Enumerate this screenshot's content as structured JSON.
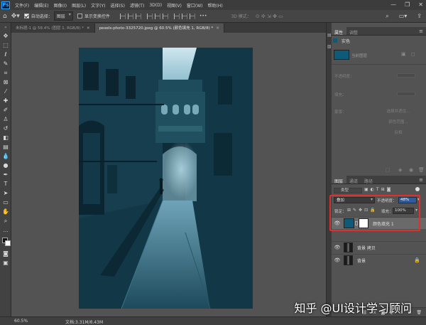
{
  "menu": {
    "logo": "Ps",
    "items": [
      "文件(F)",
      "编辑(E)",
      "图像(I)",
      "图层(L)",
      "文字(Y)",
      "选择(S)",
      "滤镜(T)",
      "3D(D)",
      "视图(V)",
      "窗口(W)",
      "帮助(H)"
    ],
    "window_controls": {
      "minimize": "—",
      "restore": "❐",
      "close": "✕"
    }
  },
  "options": {
    "auto_select_label": "自动选择：",
    "auto_select_value": "图层",
    "transform_label": "显示变换控件",
    "mode_3d_label": "3D 模式："
  },
  "tabs": [
    {
      "label": "未标题-1 @ 58.4% (图层 1, RGB/8) *",
      "active": false
    },
    {
      "label": "pexels-photo-3325720.jpeg @ 60.5% (颜色填充 1, RGB/8) *",
      "active": true
    }
  ],
  "properties_panel": {
    "tabs": [
      "属性",
      "调整"
    ],
    "title": "实色",
    "layer_comp": "当前图层",
    "labels": {
      "opacity": "不透明度：",
      "fill": "填充：",
      "mask": "蒙版："
    },
    "buttons": [
      "选择并遮住...",
      "颜色范围...",
      "反相"
    ]
  },
  "layers_panel": {
    "tabs": [
      "图层",
      "通道",
      "路径"
    ],
    "filter_kind": "类型",
    "blend_mode": "叠加",
    "opacity_label": "不透明度：",
    "opacity_value": "48%",
    "lock_label": "锁定：",
    "fill_label": "填充：",
    "fill_value": "100%",
    "layers": [
      {
        "name": "颜色填充 1",
        "selected": true,
        "locked": false
      },
      {
        "name": "背景 拷贝",
        "selected": false,
        "locked": false
      },
      {
        "name": "背景",
        "selected": false,
        "locked": true
      }
    ],
    "bottom_icons": [
      "link-icon",
      "fx-icon",
      "mask-icon",
      "adjustment-icon",
      "group-icon",
      "new-layer-icon",
      "delete-icon"
    ],
    "fx_glyph": "fx"
  },
  "status": {
    "zoom": "60.5%",
    "doc_info": "文档:3.31M/6.43M"
  },
  "colors": {
    "fill_swatch": "#0e5a78",
    "highlight_box": "#e0302d"
  },
  "watermark": "知乎 @UI设计学习顾问"
}
